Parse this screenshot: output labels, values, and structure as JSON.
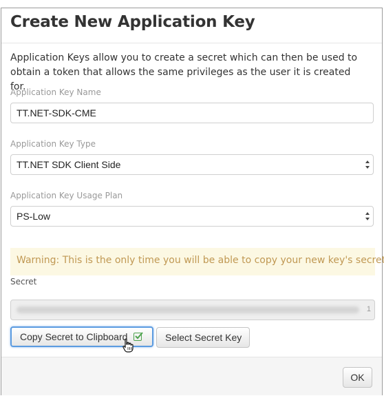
{
  "dialog": {
    "title": "Create New Application Key",
    "description": "Application Keys allow you to create a secret which can then be used to obtain a token that allows the same privileges as the user it is created for."
  },
  "form": {
    "name_label": "Application Key Name",
    "name_value": "TT.NET-SDK-CME",
    "type_label": "Application Key Type",
    "type_value": "TT.NET SDK Client Side",
    "plan_label": "Application Key Usage Plan",
    "plan_value": "PS-Low"
  },
  "warning": {
    "text": "Warning: This is the only time you will be able to copy your new key's secret."
  },
  "secret": {
    "label": "Secret",
    "value_end": "1"
  },
  "buttons": {
    "copy_label": "Copy Secret to Clipboard",
    "select_label": "Select Secret Key",
    "ok_label": "OK"
  },
  "colors": {
    "warning_bg": "#fcf8e3",
    "warning_text": "#c09853",
    "focus_ring": "#5b9be0",
    "check_green": "#4ca24c"
  },
  "icons": {
    "check": "checkbox-checked-icon",
    "cursor": "hand-pointer-icon",
    "select": "select-arrows-icon"
  }
}
